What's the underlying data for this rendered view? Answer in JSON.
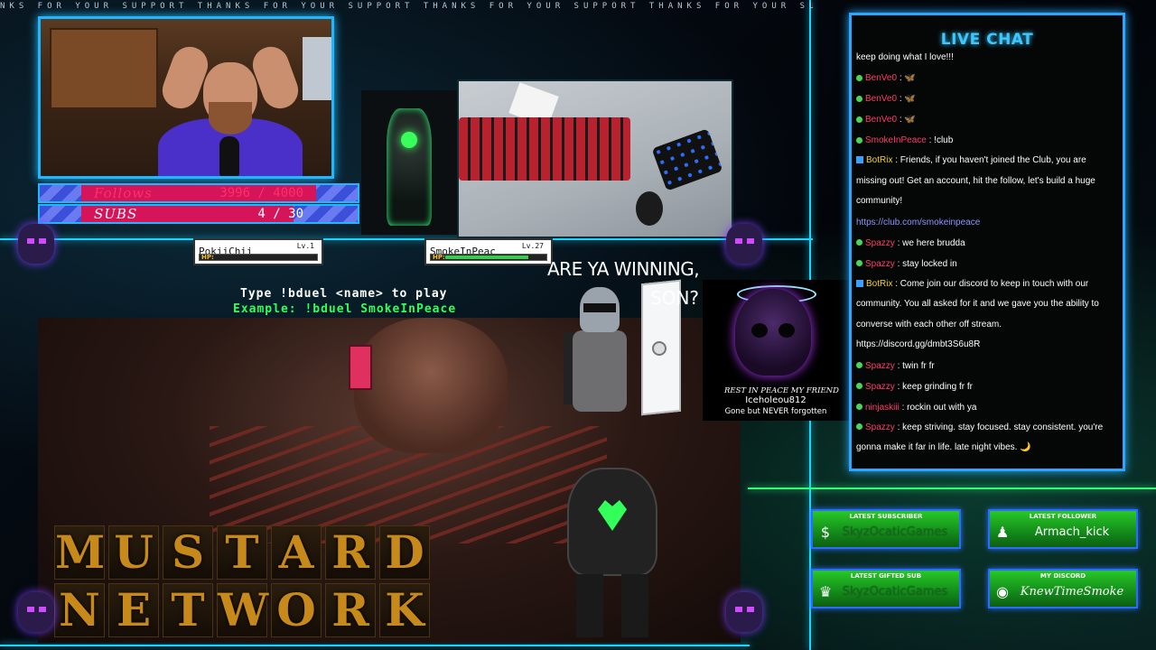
{
  "ticker": "NKS FOR YOUR SUPPORT THANKS FOR YOUR SUPPORT THANKS FOR YOUR SUPPORT THANKS FOR YOUR SUPPORT THAN",
  "goals": {
    "follows": {
      "label": "Follows",
      "count": "3996 / 4000",
      "progress": 0.999
    },
    "subs": {
      "label": "SUBS",
      "count": "4 / 30",
      "progress": 0.133
    }
  },
  "hp_cards": {
    "left": {
      "name": "PokiiChii",
      "level": "Lv.1",
      "hp_label": "HP:",
      "hp_fraction": 0.0
    },
    "right": {
      "name": "SmokeInPeac",
      "level": "Lv.27",
      "hp_label": "HP:",
      "hp_fraction": 0.85
    }
  },
  "bduel": {
    "line1": "Type !bduel <name> to play",
    "line2": "Example: !bduel SmokeInPeace"
  },
  "logo": {
    "line1": [
      "M",
      "U",
      "S",
      "T",
      "A",
      "R",
      "D"
    ],
    "line2": [
      "N",
      "E",
      "T",
      "W",
      "O",
      "R",
      "K"
    ]
  },
  "meme": {
    "title": "ARE YA WINNING,",
    "son": "SON?"
  },
  "memorial": {
    "tagline": "REST IN PEACE MY FRIEND",
    "name": "Iceholeou812",
    "subtitle": "Gone but NEVER forgotten"
  },
  "chat": {
    "title": "LIVE CHAT",
    "messages": [
      {
        "user": "",
        "text": "keep doing what I love!!!",
        "color": "#ffffff"
      },
      {
        "user": "BenVe0",
        "text": ": 🦋",
        "color": "#ff3a6a"
      },
      {
        "user": "BenVe0",
        "text": ": 🦋",
        "color": "#ff3a6a"
      },
      {
        "user": "BenVe0",
        "text": ": 🦋",
        "color": "#ff3a6a"
      },
      {
        "user": "SmokeInPeace",
        "text": ": !club",
        "color": "#ff3a6a"
      },
      {
        "user": "BotRix",
        "text": ": Friends, if you haven't joined the Club, you are missing out! Get an account, hit the follow, let's build a huge community!",
        "color": "#f0d020"
      },
      {
        "user": "",
        "text": "https://club.com/smokeinpeace",
        "color": "#8e93ff"
      },
      {
        "user": "Spazzy",
        "text": ": we here brudda",
        "color": "#ff3a6a"
      },
      {
        "user": "Spazzy",
        "text": ": stay locked in",
        "color": "#ff3a6a"
      },
      {
        "user": "BotRix",
        "text": ": Come join our discord to keep in touch with our community. You all asked for it and we gave you the ability to converse with each other off stream. https://discord.gg/dmbt3S6u8R",
        "color": "#f0d020"
      },
      {
        "user": "Spazzy",
        "text": ": twin fr fr",
        "color": "#ff3a6a"
      },
      {
        "user": "Spazzy",
        "text": ": keep grinding fr fr",
        "color": "#ff3a6a"
      },
      {
        "user": "ninjaskiii",
        "text": ": rockin out with ya",
        "color": "#ff3a6a"
      },
      {
        "user": "Spazzy",
        "text": ": keep striving. stay focused. stay consistent. you're gonna make it far in life. late night vibes. 🌙",
        "color": "#ff3a6a"
      }
    ]
  },
  "alerts": {
    "latest_subscriber": {
      "title": "LATEST SUBSCRIBER",
      "value": "SkyzOcaticGames",
      "icon": "dollar-icon"
    },
    "latest_follower": {
      "title": "LATEST FOLLOWER",
      "value": "Armach_kick",
      "icon": "users-icon"
    },
    "latest_gifted_sub": {
      "title": "LATEST GIFTED SUB",
      "value": "SkyzOcaticGames",
      "icon": "crown-icon"
    },
    "my_discord": {
      "title": "MY DISCORD",
      "value": "KnewTimeSmoke",
      "icon": "discord-icon"
    }
  },
  "colors": {
    "accent_cyan": "#19d6ff",
    "accent_green": "#2fff7a",
    "goal_pink": "#d6145a",
    "chat_title": "#3ec7ff"
  }
}
